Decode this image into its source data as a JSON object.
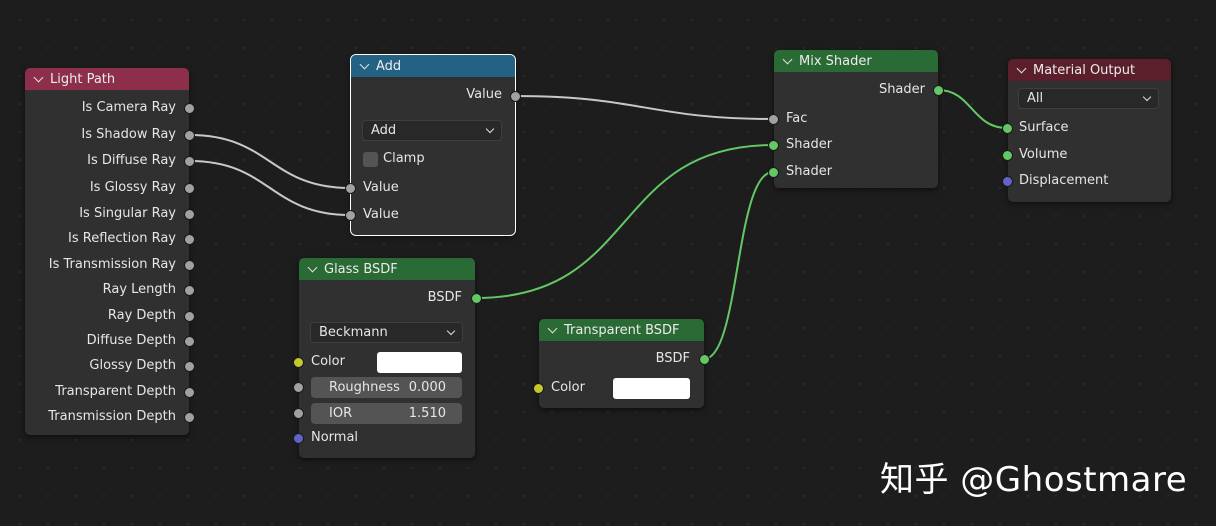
{
  "nodes": {
    "light_path": {
      "title": "Light Path",
      "outputs": [
        "Is Camera Ray",
        "Is Shadow Ray",
        "Is Diffuse Ray",
        "Is Glossy Ray",
        "Is Singular Ray",
        "Is Reflection Ray",
        "Is Transmission Ray",
        "Ray Length",
        "Ray Depth",
        "Diffuse Depth",
        "Glossy Depth",
        "Transparent Depth",
        "Transmission Depth"
      ]
    },
    "add": {
      "title": "Add",
      "output": "Value",
      "operation": "Add",
      "clamp_label": "Clamp",
      "clamp_checked": false,
      "inputs": [
        "Value",
        "Value"
      ]
    },
    "glass_bsdf": {
      "title": "Glass BSDF",
      "output": "BSDF",
      "distribution": "Beckmann",
      "color_label": "Color",
      "color_value": "#ffffff",
      "roughness_label": "Roughness",
      "roughness_value": "0.000",
      "ior_label": "IOR",
      "ior_value": "1.510",
      "normal_label": "Normal"
    },
    "transparent_bsdf": {
      "title": "Transparent BSDF",
      "output": "BSDF",
      "color_label": "Color",
      "color_value": "#ffffff"
    },
    "mix_shader": {
      "title": "Mix Shader",
      "output": "Shader",
      "inputs": [
        "Fac",
        "Shader",
        "Shader"
      ]
    },
    "material_output": {
      "title": "Material Output",
      "target": "All",
      "inputs": [
        "Surface",
        "Volume",
        "Displacement"
      ]
    }
  },
  "colors": {
    "input_header": "#8d2e4a",
    "converter_header": "#246283",
    "shader_header": "#2a6a34",
    "output_header": "#5b1f2c",
    "shader_link": "#63c763",
    "value_link": "#c8c8c8"
  },
  "watermark": "知乎 @Ghostmare"
}
